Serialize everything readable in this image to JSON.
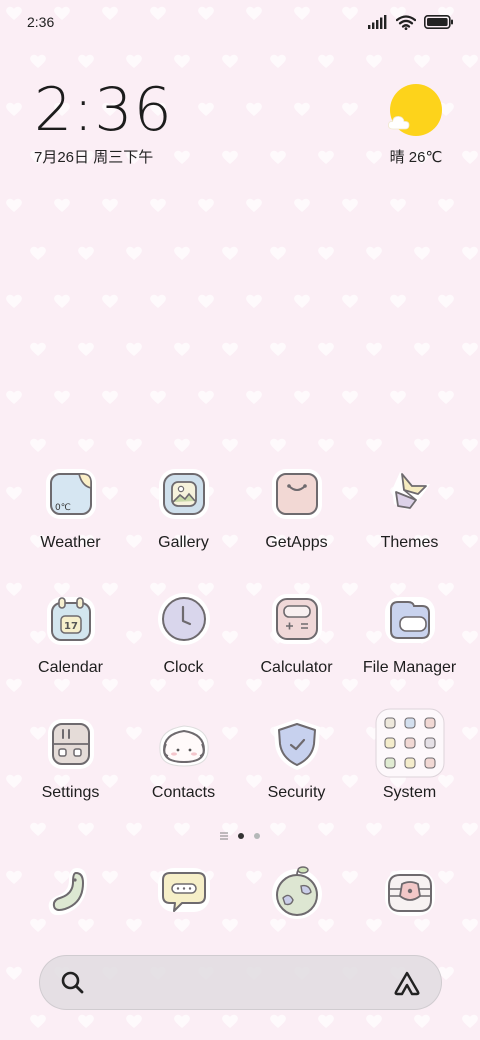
{
  "status_bar": {
    "time": "2:36"
  },
  "clock_widget": {
    "time": "2:36",
    "date": "7月26日 周三下午"
  },
  "weather_widget": {
    "text": "晴 26℃",
    "icon": "sunny-cloud-icon"
  },
  "apps": [
    {
      "id": "weather",
      "label": "Weather",
      "icon": "weather-icon",
      "badge_text": "0℃"
    },
    {
      "id": "gallery",
      "label": "Gallery",
      "icon": "gallery-icon"
    },
    {
      "id": "getapps",
      "label": "GetApps",
      "icon": "getapps-icon"
    },
    {
      "id": "themes",
      "label": "Themes",
      "icon": "themes-icon"
    },
    {
      "id": "calendar",
      "label": "Calendar",
      "icon": "calendar-icon",
      "badge_text": "17"
    },
    {
      "id": "clock",
      "label": "Clock",
      "icon": "clock-icon"
    },
    {
      "id": "calculator",
      "label": "Calculator",
      "icon": "calculator-icon"
    },
    {
      "id": "file-manager",
      "label": "File Manager",
      "icon": "folder-icon"
    },
    {
      "id": "settings",
      "label": "Settings",
      "icon": "settings-icon"
    },
    {
      "id": "contacts",
      "label": "Contacts",
      "icon": "contacts-icon"
    },
    {
      "id": "security",
      "label": "Security",
      "icon": "shield-icon"
    },
    {
      "id": "system",
      "label": "System",
      "icon": "system-folder-icon"
    }
  ],
  "page_indicator": {
    "pages": 2,
    "current": 1
  },
  "dock": [
    {
      "id": "phone",
      "icon": "phone-icon"
    },
    {
      "id": "messages",
      "icon": "messages-icon"
    },
    {
      "id": "browser",
      "icon": "globe-icon"
    },
    {
      "id": "camera",
      "icon": "camera-icon"
    }
  ],
  "search_bar": {
    "left_icon": "search-icon",
    "right_icon": "assistant-icon"
  },
  "colors": {
    "wallpaper": "#fbeef5",
    "heart": "#ffffff",
    "sun": "#fdd31b",
    "icon_outline": "#6e6a6e",
    "icon_ring": "#ffffff"
  }
}
